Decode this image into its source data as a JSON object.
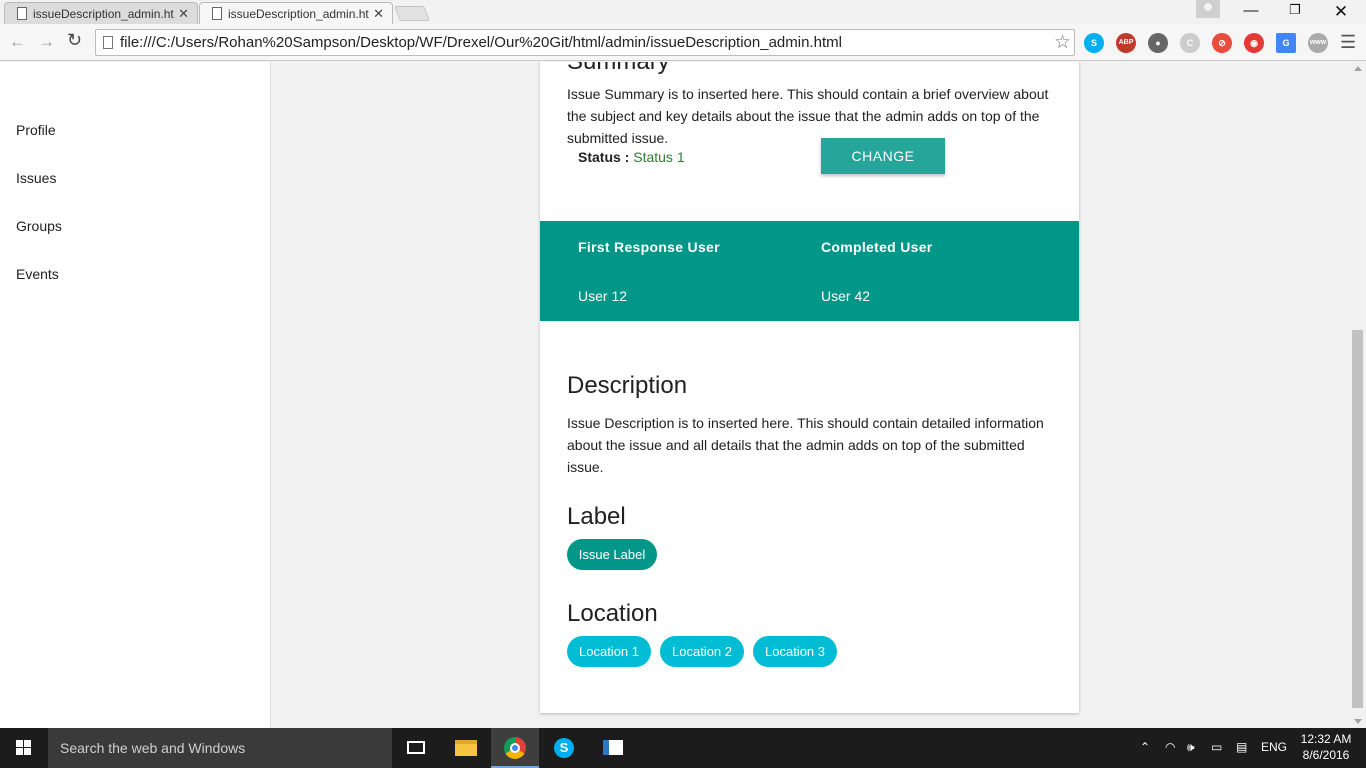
{
  "browser": {
    "tabs": [
      {
        "title": "issueDescription_admin.ht",
        "active": false
      },
      {
        "title": "issueDescription_admin.ht",
        "active": true
      }
    ],
    "url": "file:///C:/Users/Rohan%20Sampson/Desktop/WF/Drexel/Our%20Git/html/admin/issueDescription_admin.html",
    "extensions": [
      "skype-icon",
      "adblock-icon",
      "bulb-icon",
      "refresh-ext-icon",
      "blocker-icon",
      "record-icon",
      "translate-icon",
      "www-icon"
    ]
  },
  "sidebar": {
    "items": [
      {
        "label": "Profile"
      },
      {
        "label": "Issues"
      },
      {
        "label": "Groups"
      },
      {
        "label": "Events"
      }
    ]
  },
  "issue": {
    "summary_heading": "Summary",
    "summary_text": "Issue Summary is to inserted here. This should contain a brief overview about the subject and key details about the issue that the admin adds on top of the submitted issue.",
    "status_label": "Status :",
    "status_value": "Status 1",
    "change_button": "CHANGE",
    "first_response_header": "First Response User",
    "completed_header": "Completed User",
    "first_response_user": "User 12",
    "completed_user": "User 42",
    "description_heading": "Description",
    "description_text": "Issue Description is to inserted here. This should contain detailed information about the issue and all details that the admin adds on top of the submitted issue.",
    "label_heading": "Label",
    "labels": [
      "Issue Label"
    ],
    "location_heading": "Location",
    "locations": [
      "Location 1",
      "Location 2",
      "Location 3"
    ]
  },
  "colors": {
    "teal": "#009688",
    "button": "#26a69a",
    "location_chip": "#00bcd4",
    "status_green": "#2e7d32"
  },
  "taskbar": {
    "search_placeholder": "Search the web and Windows",
    "language": "ENG",
    "time": "12:32 AM",
    "date": "8/6/2016"
  }
}
